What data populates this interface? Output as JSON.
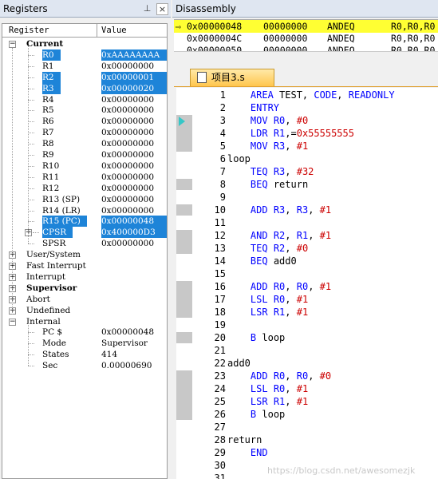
{
  "registers_pane": {
    "title": "Registers",
    "pin": "⊥",
    "close": "×",
    "col_register": "Register",
    "col_value": "Value"
  },
  "current_group": "Current",
  "registers": [
    {
      "name": "R0",
      "value": "0xAAAAAAAA",
      "selected": true
    },
    {
      "name": "R1",
      "value": "0x00000000",
      "selected": false
    },
    {
      "name": "R2",
      "value": "0x00000001",
      "selected": true
    },
    {
      "name": "R3",
      "value": "0x00000020",
      "selected": true
    },
    {
      "name": "R4",
      "value": "0x00000000",
      "selected": false
    },
    {
      "name": "R5",
      "value": "0x00000000",
      "selected": false
    },
    {
      "name": "R6",
      "value": "0x00000000",
      "selected": false
    },
    {
      "name": "R7",
      "value": "0x00000000",
      "selected": false
    },
    {
      "name": "R8",
      "value": "0x00000000",
      "selected": false
    },
    {
      "name": "R9",
      "value": "0x00000000",
      "selected": false
    },
    {
      "name": "R10",
      "value": "0x00000000",
      "selected": false
    },
    {
      "name": "R11",
      "value": "0x00000000",
      "selected": false
    },
    {
      "name": "R12",
      "value": "0x00000000",
      "selected": false
    },
    {
      "name": "R13 (SP)",
      "value": "0x00000000",
      "selected": false
    },
    {
      "name": "R14 (LR)",
      "value": "0x00000000",
      "selected": false
    },
    {
      "name": "R15 (PC)",
      "value": "0x00000048",
      "selected": true
    },
    {
      "name": "CPSR",
      "value": "0x400000D3",
      "selected": true
    },
    {
      "name": "SPSR",
      "value": "0x00000000",
      "selected": false
    }
  ],
  "modes": [
    "User/System",
    "Fast Interrupt",
    "Interrupt",
    "Supervisor",
    "Abort",
    "Undefined",
    "Internal"
  ],
  "internal": [
    {
      "name": "PC  $",
      "value": "0x00000048"
    },
    {
      "name": "Mode",
      "value": "Supervisor"
    },
    {
      "name": "States",
      "value": "414"
    },
    {
      "name": "Sec",
      "value": "0.00000690"
    }
  ],
  "disassembly": {
    "title": "Disassembly",
    "rows": [
      {
        "addr": "0x00000048",
        "code": "00000000",
        "mnem": "ANDEQ",
        "ops": "R0,R0,R0",
        "current": true
      },
      {
        "addr": "0x0000004C",
        "code": "00000000",
        "mnem": "ANDEQ",
        "ops": "R0,R0,R0",
        "current": false
      },
      {
        "addr": "0x00000050",
        "code": "00000000",
        "mnem": "ANDEQ",
        "ops": "R0,R0,R0",
        "current": false
      }
    ]
  },
  "editor_tab": "项目3.s",
  "code_lines": [
    {
      "n": "1",
      "t": "    AREA TEST, CODE, READONLY"
    },
    {
      "n": "2",
      "t": "    ENTRY"
    },
    {
      "n": "3",
      "t": "    MOV R0, #0"
    },
    {
      "n": "4",
      "t": "    LDR R1,=0x55555555"
    },
    {
      "n": "5",
      "t": "    MOV R3, #1"
    },
    {
      "n": "6",
      "t": "loop"
    },
    {
      "n": "7",
      "t": "    TEQ R3, #32"
    },
    {
      "n": "8",
      "t": "    BEQ return"
    },
    {
      "n": "9",
      "t": ""
    },
    {
      "n": "10",
      "t": "    ADD R3, R3, #1"
    },
    {
      "n": "11",
      "t": ""
    },
    {
      "n": "12",
      "t": "    AND R2, R1, #1"
    },
    {
      "n": "13",
      "t": "    TEQ R2, #0"
    },
    {
      "n": "14",
      "t": "    BEQ add0"
    },
    {
      "n": "15",
      "t": ""
    },
    {
      "n": "16",
      "t": "    ADD R0, R0, #1"
    },
    {
      "n": "17",
      "t": "    LSL R0, #1"
    },
    {
      "n": "18",
      "t": "    LSR R1, #1"
    },
    {
      "n": "19",
      "t": ""
    },
    {
      "n": "20",
      "t": "    B loop"
    },
    {
      "n": "21",
      "t": ""
    },
    {
      "n": "22",
      "t": "add0"
    },
    {
      "n": "23",
      "t": "    ADD R0, R0, #0"
    },
    {
      "n": "24",
      "t": "    LSL R0, #1"
    },
    {
      "n": "25",
      "t": "    LSR R1, #1"
    },
    {
      "n": "26",
      "t": "    B loop"
    },
    {
      "n": "27",
      "t": ""
    },
    {
      "n": "28",
      "t": "return"
    },
    {
      "n": "29",
      "t": "    END"
    },
    {
      "n": "30",
      "t": ""
    },
    {
      "n": "31",
      "t": ""
    }
  ],
  "watermark": "https://blog.csdn.net/awesomezjk",
  "colors": {
    "selection": "#1e84d8",
    "current_line": "#ffff33",
    "keyword": "#0000ff",
    "number": "#cc0000"
  }
}
